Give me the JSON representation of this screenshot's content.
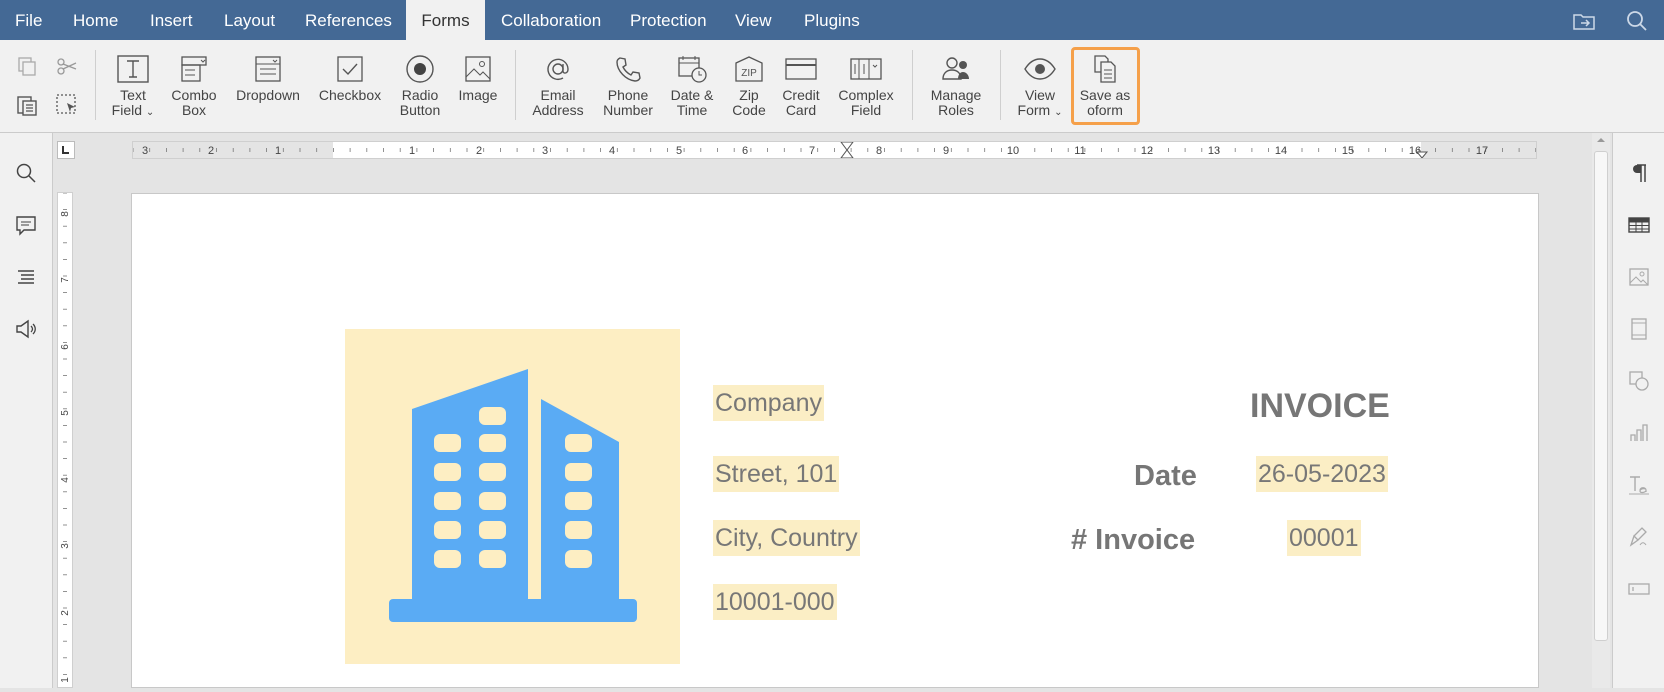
{
  "menu": {
    "tabs": [
      "File",
      "Home",
      "Insert",
      "Layout",
      "References",
      "Forms",
      "Collaboration",
      "Protection",
      "View",
      "Plugins"
    ],
    "active": "Forms"
  },
  "toolbar": {
    "text_field": [
      "Text",
      "Field"
    ],
    "combo_box": [
      "Combo",
      "Box"
    ],
    "dropdown": "Dropdown",
    "checkbox": "Checkbox",
    "radio_button": [
      "Radio",
      "Button"
    ],
    "image": "Image",
    "email_address": [
      "Email",
      "Address"
    ],
    "phone_number": [
      "Phone",
      "Number"
    ],
    "date_time": [
      "Date &",
      "Time"
    ],
    "zip_code": [
      "Zip",
      "Code"
    ],
    "credit_card": [
      "Credit",
      "Card"
    ],
    "complex_field": [
      "Complex",
      "Field"
    ],
    "manage_roles": [
      "Manage",
      "Roles"
    ],
    "view_form": [
      "View",
      "Form"
    ],
    "save_as_oform": [
      "Save as",
      "oform"
    ],
    "zip_glyph": "ZIP"
  },
  "ruler": {
    "left_numbers": [
      "3",
      "2",
      "1"
    ],
    "right_numbers": [
      "1",
      "2",
      "3",
      "4",
      "5",
      "6",
      "7",
      "8",
      "9",
      "10",
      "11",
      "12",
      "13",
      "14",
      "15",
      "16",
      "17"
    ],
    "vertical_numbers": [
      "8",
      "7",
      "6",
      "5",
      "4",
      "3",
      "2",
      "1"
    ]
  },
  "document": {
    "company": "Company",
    "street": "Street, 101",
    "city": "City, Country",
    "zip": "10001-000",
    "invoice_title": "INVOICE",
    "date_label": "Date",
    "date_value": "26-05-2023",
    "invoice_label": "# Invoice",
    "invoice_value": "00001"
  },
  "colors": {
    "menubar": "#446995",
    "highlight": "#f5a04a",
    "logo_bg": "#fdeec3",
    "building": "#5aabf4"
  }
}
